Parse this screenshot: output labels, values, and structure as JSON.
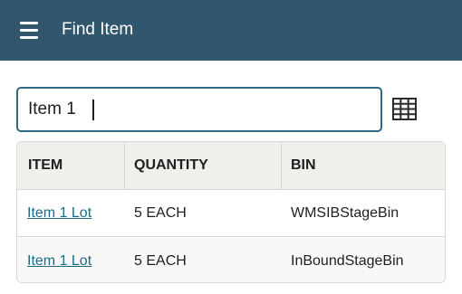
{
  "header": {
    "title": "Find Item",
    "menu_icon": "hamburger-menu-icon",
    "background": "#31576e"
  },
  "search": {
    "value": "Item 1",
    "scan_icon": "grid-icon"
  },
  "table": {
    "columns": [
      "ITEM",
      "QUANTITY",
      "BIN"
    ],
    "rows": [
      {
        "item": "Item 1 Lot",
        "quantity": "5 EACH",
        "bin": "WMSIBStageBin"
      },
      {
        "item": "Item 1 Lot",
        "quantity": "5 EACH",
        "bin": "InBoundStageBin"
      }
    ]
  },
  "colors": {
    "link": "#1c6b87",
    "input_border": "#2f6b82",
    "table_header_bg": "#f1efec"
  }
}
